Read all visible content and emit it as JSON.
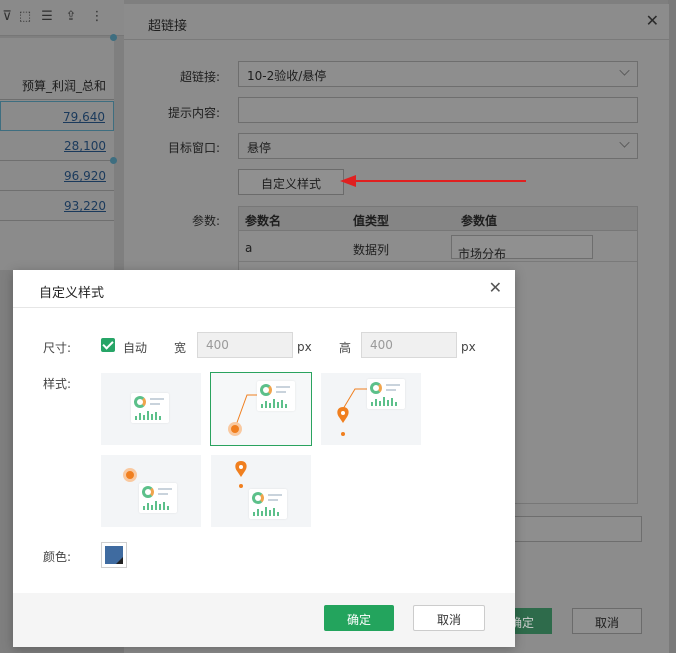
{
  "background": {
    "column_header": "预算_利润_总和",
    "rows": [
      "79,640",
      "28,100",
      "96,920",
      "93,220"
    ],
    "toolbar_icons": [
      "filter-icon",
      "select-icon",
      "list-icon",
      "export-icon",
      "more-icon"
    ]
  },
  "outer_dialog": {
    "title": "超链接",
    "close_glyph": "✕",
    "hyperlink_label": "超链接:",
    "hyperlink_value": "10-2验收/悬停",
    "tip_label": "提示内容:",
    "tip_value": "",
    "target_label": "目标窗口:",
    "target_value": "悬停",
    "custom_style_button": "自定义样式",
    "params_label": "参数:",
    "param_headers": [
      "参数名",
      "值类型",
      "参数值"
    ],
    "param_row": {
      "name": "a",
      "type": "数据列",
      "value": "市场分布"
    },
    "ok_label": "确定",
    "cancel_label": "取消"
  },
  "annotation": {
    "arrow_color": "#e02020"
  },
  "dialog": {
    "title": "自定义样式",
    "close_glyph": "✕",
    "size_label": "尺寸:",
    "auto_label": "自动",
    "auto_checked": true,
    "width_label": "宽",
    "width_value": "400",
    "height_label": "高",
    "height_value": "400",
    "unit": "px",
    "style_label": "样式:",
    "styles": [
      "center",
      "bottom-left-dot",
      "bottom-left-pin",
      "top-left-dot",
      "top-left-pin"
    ],
    "selected_style_index": 1,
    "color_label": "颜色:",
    "color_value": "#3f6ba0",
    "ok_label": "确定",
    "cancel_label": "取消"
  },
  "colors": {
    "accent": "#23a45d",
    "marker": "#f07f1f"
  }
}
